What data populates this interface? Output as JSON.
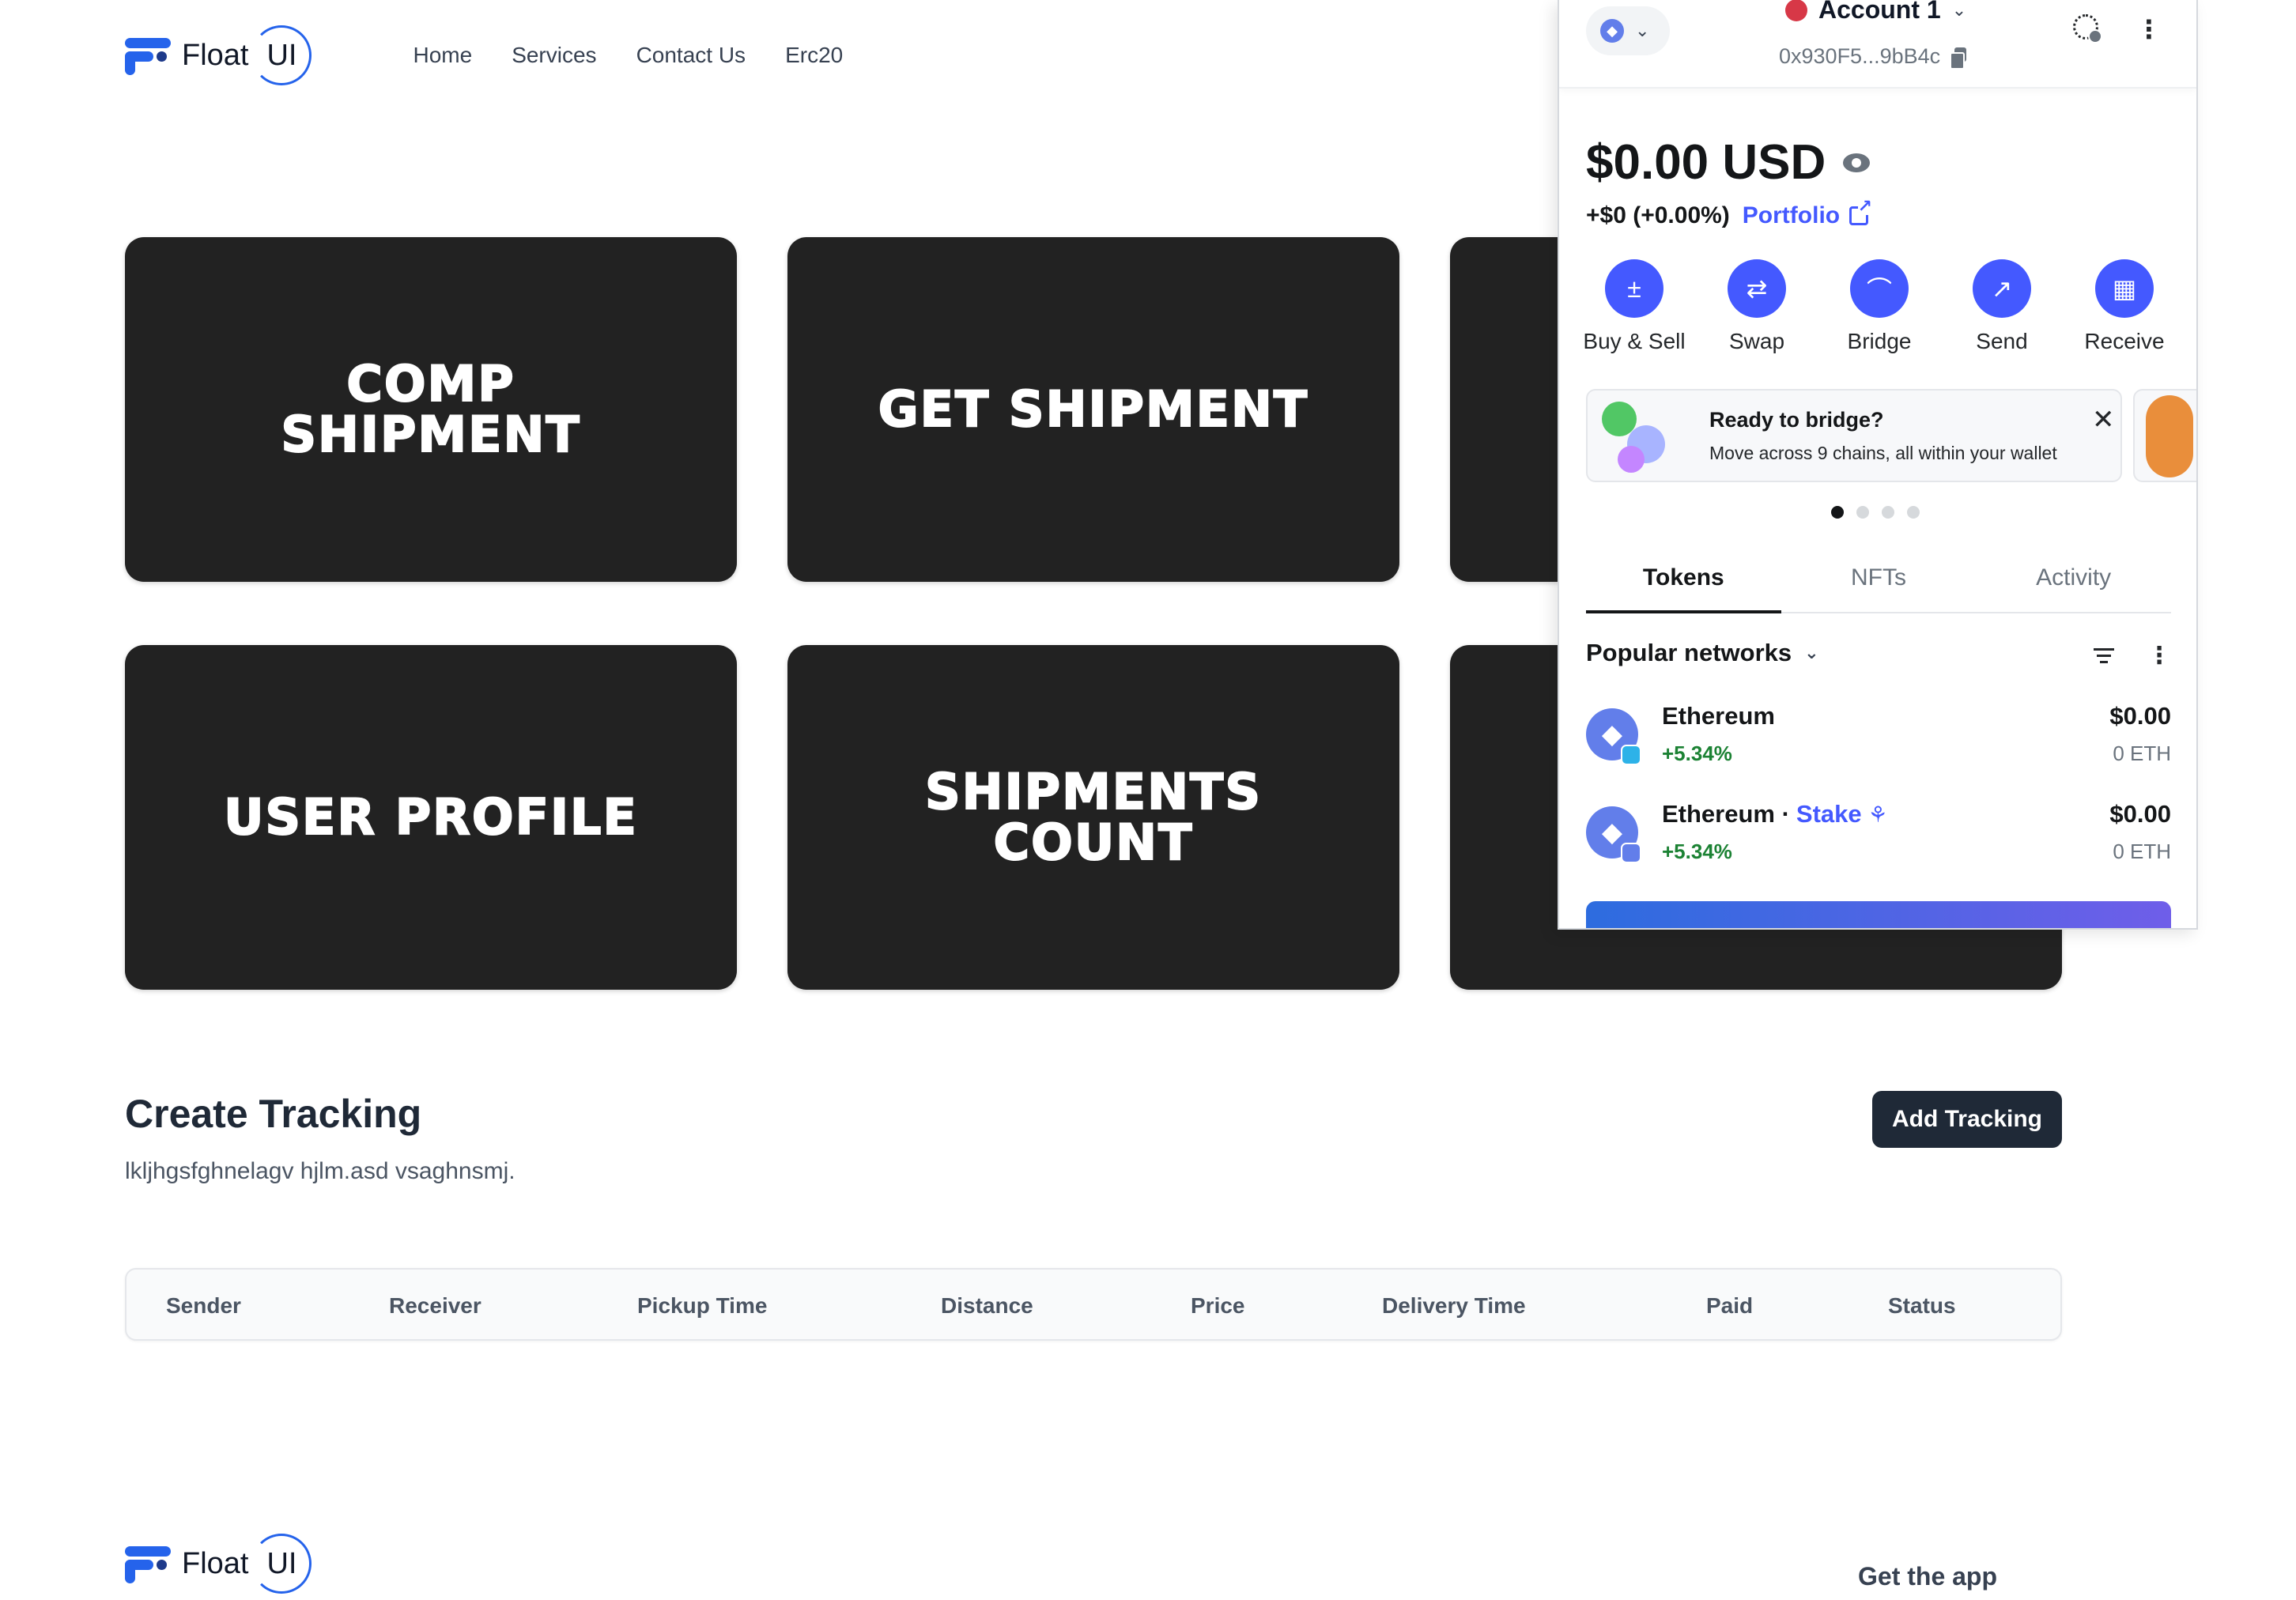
{
  "nav": {
    "brand": "Float",
    "brand_ui": "UI",
    "links": [
      "Home",
      "Services",
      "Contact Us",
      "Erc20"
    ]
  },
  "cards": [
    "COMP SHIPMENT",
    "GET SHIPMENT",
    "",
    "USER PROFILE",
    "SHIPMENTS COUNT",
    ""
  ],
  "tracking": {
    "title": "Create Tracking",
    "description": "lkljhgsfghnelagv hjlm.asd vsaghnsmj.",
    "add_button": "Add Tracking",
    "columns": [
      "Sender",
      "Receiver",
      "Pickup Time",
      "Distance",
      "Price",
      "Delivery Time",
      "Paid",
      "Status"
    ]
  },
  "footer": {
    "brand": "Float",
    "brand_ui": "UI",
    "get_app": "Get the app"
  },
  "wallet": {
    "account_name": "Account 1",
    "address": "0x930F5...9bB4c",
    "balance": "$0.00 USD",
    "change": "+$0 (+0.00%)",
    "portfolio_label": "Portfolio",
    "actions": [
      "Buy & Sell",
      "Swap",
      "Bridge",
      "Send",
      "Receive"
    ],
    "action_icons": [
      "plus-minus-icon",
      "swap-icon",
      "bridge-icon",
      "send-icon",
      "receive-icon"
    ],
    "banner": {
      "title": "Ready to bridge?",
      "text": "Move across 9 chains, all within your wallet"
    },
    "carousel_active_index": 0,
    "carousel_count": 4,
    "tabs": [
      "Tokens",
      "NFTs",
      "Activity"
    ],
    "active_tab": "Tokens",
    "networks_label": "Popular networks",
    "tokens": [
      {
        "name": "Ethereum",
        "stake_label": "",
        "change": "+5.34%",
        "value": "$0.00",
        "amount": "0 ETH"
      },
      {
        "name": "Ethereum ·",
        "stake_label": "Stake",
        "change": "+5.34%",
        "value": "$0.00",
        "amount": "0 ETH"
      }
    ],
    "colors": {
      "accent": "#4459ff",
      "positive": "#1c8234",
      "account_dot": "#d73847"
    }
  }
}
